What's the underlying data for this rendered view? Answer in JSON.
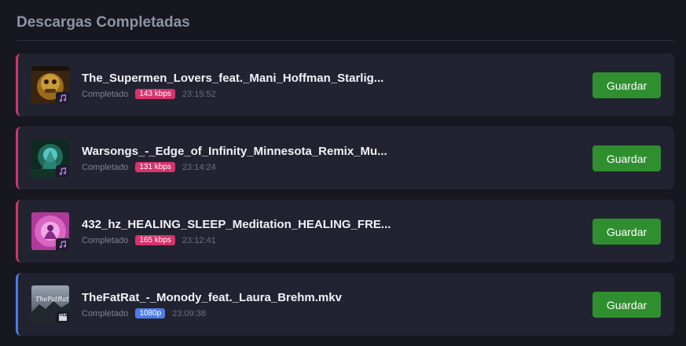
{
  "section": {
    "title": "Descargas Completadas"
  },
  "colors": {
    "audio_accent": "#d6336c",
    "video_accent": "#4c7de8",
    "save_button": "#2f8f2f"
  },
  "downloads": [
    {
      "title": "The_Supermen_Lovers_feat._Mani_Hoffman_Starlig...",
      "status": "Completado",
      "quality": "143 kbps",
      "time": "23:15:52",
      "type": "audio",
      "type_icon": "music-note-icon",
      "save_label": "Guardar"
    },
    {
      "title": "Warsongs_-_Edge_of_Infinity_Minnesota_Remix_Mu...",
      "status": "Completado",
      "quality": "131 kbps",
      "time": "23:14:24",
      "type": "audio",
      "type_icon": "music-note-icon",
      "save_label": "Guardar"
    },
    {
      "title": "432_hz_HEALING_SLEEP_Meditation_HEALING_FRE...",
      "status": "Completado",
      "quality": "165 kbps",
      "time": "23:12:41",
      "type": "audio",
      "type_icon": "music-note-icon",
      "save_label": "Guardar"
    },
    {
      "title": "TheFatRat_-_Monody_feat._Laura_Brehm.mkv",
      "status": "Completado",
      "quality": "1080p",
      "time": "23:09:38",
      "type": "video",
      "type_icon": "clapperboard-icon",
      "save_label": "Guardar",
      "thumb_text": "TheFatRat"
    }
  ]
}
